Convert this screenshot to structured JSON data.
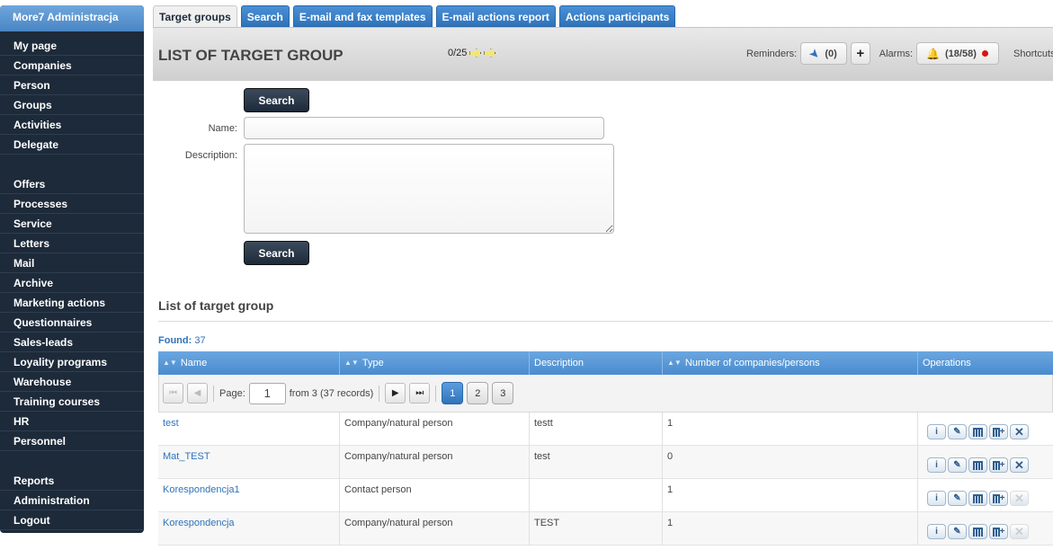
{
  "sidebar": {
    "header": "More7 Administracja",
    "items": [
      {
        "label": "My page"
      },
      {
        "label": "Companies"
      },
      {
        "label": "Person"
      },
      {
        "label": "Groups"
      },
      {
        "label": "Activities"
      },
      {
        "label": "Delegate"
      },
      {
        "label": ""
      },
      {
        "label": "Offers"
      },
      {
        "label": "Processes"
      },
      {
        "label": "Service"
      },
      {
        "label": "Letters"
      },
      {
        "label": "Mail"
      },
      {
        "label": "Archive"
      },
      {
        "label": "Marketing actions"
      },
      {
        "label": "Questionnaires"
      },
      {
        "label": "Sales-leads"
      },
      {
        "label": "Loyality programs"
      },
      {
        "label": "Warehouse"
      },
      {
        "label": "Training courses"
      },
      {
        "label": "HR"
      },
      {
        "label": "Personnel"
      },
      {
        "label": ""
      },
      {
        "label": "Reports"
      },
      {
        "label": "Administration"
      },
      {
        "label": "Logout"
      }
    ]
  },
  "tabs": [
    "Target groups",
    "Search",
    "E-mail and fax templates",
    "E-mail actions report",
    "Actions participants"
  ],
  "header": {
    "title": "LIST OF TARGET GROUP",
    "counter": "0/25",
    "reminders_label": "Reminders:",
    "reminders_count": "(0)",
    "alarms_label": "Alarms:",
    "alarms_count": "(18/58)",
    "shortcuts_label": "Shortcuts:"
  },
  "form": {
    "search_label": "Search",
    "name_label": "Name:",
    "description_label": "Description:",
    "name_value": "",
    "description_value": ""
  },
  "list": {
    "title": "List of target group",
    "found_label": "Found:",
    "found_value": "37",
    "columns": [
      "Name",
      "Type",
      "Description",
      "Number of companies/persons",
      "Operations"
    ],
    "pager": {
      "page_label": "Page:",
      "page_value": "1",
      "from_text": "from 3 (37 records)",
      "pages": [
        "1",
        "2",
        "3"
      ]
    },
    "rows": [
      {
        "name": "test",
        "type": "Company/natural person",
        "description": "testt",
        "count": "1",
        "deletable": true
      },
      {
        "name": "Mat_TEST",
        "type": "Company/natural person",
        "description": "test",
        "count": "0",
        "deletable": true
      },
      {
        "name": "Korespondencja1",
        "type": "Contact person",
        "description": "",
        "count": "1",
        "deletable": false
      },
      {
        "name": "Korespondencja",
        "type": "Company/natural person",
        "description": "TEST",
        "count": "1",
        "deletable": false
      }
    ]
  },
  "colors": {
    "accent": "#2f73bb",
    "sidebar_bg": "#1d2a3a"
  }
}
